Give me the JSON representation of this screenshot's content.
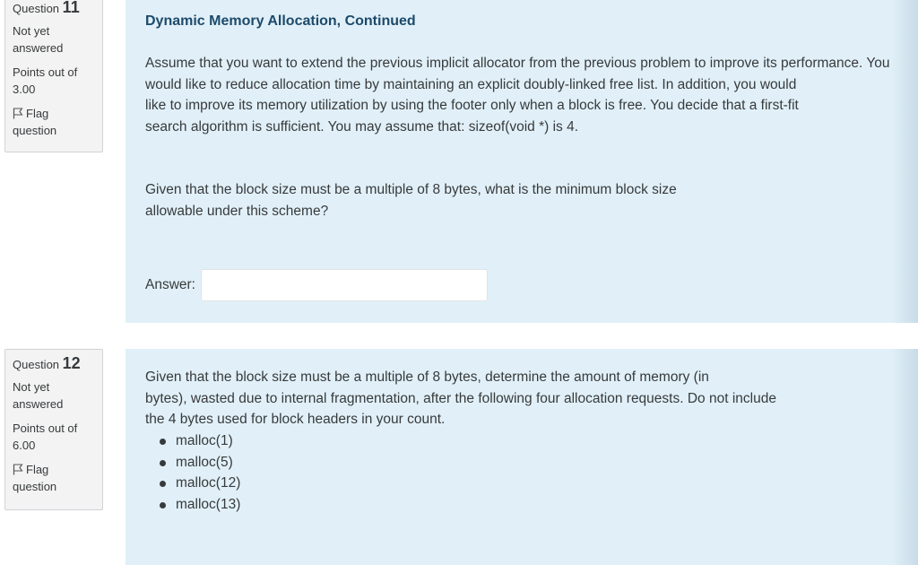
{
  "q11": {
    "label": "Question",
    "number": "11",
    "state": [
      "Not yet",
      "answered"
    ],
    "grade": [
      "Points out of",
      "3.00"
    ],
    "flag": [
      "Flag",
      "question"
    ],
    "title": "Dynamic Memory Allocation, Continued",
    "paragraph1": [
      "Assume that you want to extend the previous implicit allocator from the previous problem to improve its performance. You",
      "would like to reduce allocation time by maintaining an explicit doubly-linked free list. In addition, you would",
      "like to improve its memory utilization by using the footer only when a block is free. You decide that a first-fit",
      "search algorithm is sufficient. You may assume that: sizeof(void *) is 4."
    ],
    "paragraph2": [
      "Given that the block size must be a multiple of 8 bytes, what is the minimum block size",
      "allowable under this scheme?"
    ],
    "answer_label": "Answer:",
    "answer_value": ""
  },
  "q12": {
    "label": "Question",
    "number": "12",
    "state": [
      "Not yet",
      "answered"
    ],
    "grade": [
      "Points out of",
      "6.00"
    ],
    "flag": [
      "Flag",
      "question"
    ],
    "paragraph": [
      "Given that the block size must be a multiple of 8 bytes, determine the amount of memory (in",
      "bytes), wasted due to internal fragmentation, after the following four allocation requests. Do not include",
      "the 4 bytes used for block headers in your count."
    ],
    "requests": [
      "malloc(1)",
      "malloc(5)",
      "malloc(12)",
      "malloc(13)"
    ]
  }
}
